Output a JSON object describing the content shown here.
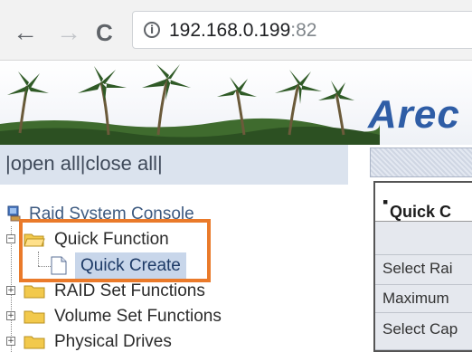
{
  "browser": {
    "url_host": "192.168.0.199",
    "url_port": ":82",
    "back_icon": "←",
    "forward_icon": "→",
    "reload_icon": "C",
    "info_icon": "i"
  },
  "banner": {
    "brand": "Arec"
  },
  "tree": {
    "open_close": "|open all|close all|",
    "console": "Raid System Console",
    "items": [
      {
        "label": "Quick Function"
      },
      {
        "label": "Quick Create"
      },
      {
        "label": "RAID Set Functions"
      },
      {
        "label": "Volume Set Functions"
      },
      {
        "label": "Physical Drives"
      }
    ]
  },
  "main": {
    "header": "Quick C",
    "rows": [
      "",
      "Select Rai",
      "Maximum",
      "Select Cap"
    ]
  },
  "colors": {
    "highlight": "#ea7a2a",
    "brand": "#2f5da6",
    "selected": "#c8d6ea"
  }
}
